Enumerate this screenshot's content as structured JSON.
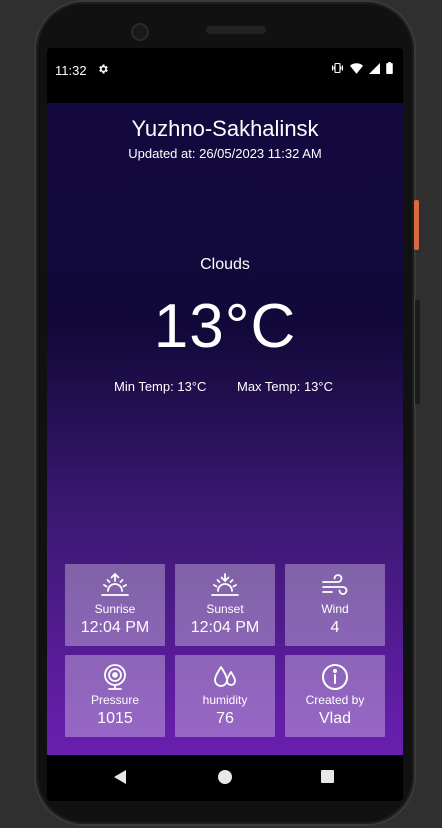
{
  "status_bar": {
    "time": "11:32",
    "icons": [
      "settings-gear-icon",
      "vibrate-icon",
      "wifi-icon",
      "signal-icon",
      "battery-icon"
    ]
  },
  "weather": {
    "city": "Yuzhno-Sakhalinsk",
    "updated": "Updated at: 26/05/2023 11:32 AM",
    "condition": "Clouds",
    "temperature": "13°C",
    "min_temp": "Min Temp: 13°C",
    "max_temp": "Max Temp: 13°C"
  },
  "tiles": [
    {
      "icon": "sunrise-icon",
      "label": "Sunrise",
      "value": "12:04 PM"
    },
    {
      "icon": "sunset-icon",
      "label": "Sunset",
      "value": "12:04 PM"
    },
    {
      "icon": "wind-icon",
      "label": "Wind",
      "value": "4"
    },
    {
      "icon": "pressure-icon",
      "label": "Pressure",
      "value": "1015"
    },
    {
      "icon": "humidity-icon",
      "label": "humidity",
      "value": "76"
    },
    {
      "icon": "info-icon",
      "label": "Created by",
      "value": "Vlad"
    }
  ],
  "colors": {
    "gradient_top": "#13093f",
    "gradient_bottom": "#6a1fb0",
    "tile_background": "rgba(255,255,255,0.32)",
    "text": "#ffffff"
  }
}
